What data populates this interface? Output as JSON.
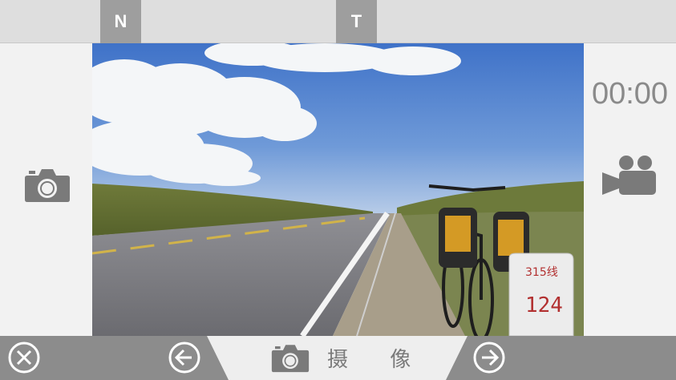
{
  "top_tabs": [
    {
      "label": "N"
    },
    {
      "label": "T"
    }
  ],
  "timer": {
    "value": "00:00"
  },
  "bottom": {
    "mode_label": "摄 像"
  },
  "viewfinder": {
    "milestone_top": "315线",
    "milestone_bottom": "124"
  },
  "icons": {
    "close": "close-circle-icon",
    "prev": "arrow-left-circle-icon",
    "next": "arrow-right-circle-icon",
    "photo": "camera-icon",
    "video": "video-camera-icon"
  },
  "colors": {
    "bar": "#8c8c8c",
    "tab": "#9e9e9e",
    "icon": "#7a7a7a"
  }
}
